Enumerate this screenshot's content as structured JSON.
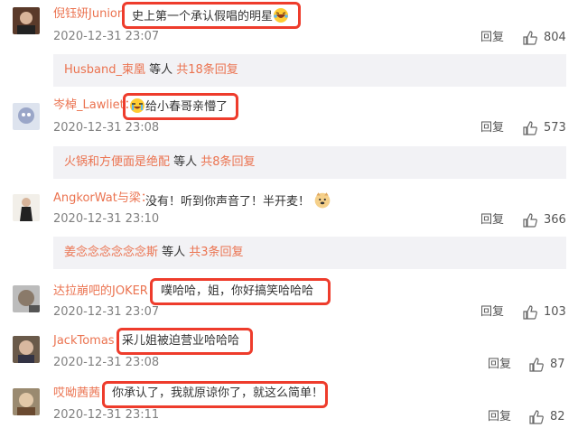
{
  "comments": [
    {
      "user": "倪钰妍Junior",
      "text": "史上第一个承认假唱的明星",
      "emoji_icon": "laughing-tears-emoji",
      "time": "2020-12-31 23:07",
      "reply": "回复",
      "likes": "804",
      "sub": {
        "name": "Husband_柬凰",
        "mid": " 等人 ",
        "count": "共18条回复"
      }
    },
    {
      "user": "岑棹_Lawliet",
      "sep": "：",
      "text": "给小春哥亲懵了",
      "emoji_icon": "crying-laugh-emoji",
      "time": "2020-12-31 23:08",
      "reply": "回复",
      "likes": "573",
      "sub": {
        "name": "火锅和方便面是绝配",
        "mid": " 等人 ",
        "count": "共8条回复"
      }
    },
    {
      "user": "AngkorWat与梁",
      "sep": "：",
      "text": "没有！听到你声音了！半开麦！",
      "emoji_icon": "doge-emoji",
      "time": "2020-12-31 23:10",
      "reply": "回复",
      "likes": "366",
      "sub": {
        "name": "姜念念念念念念斯",
        "mid": " 等人 ",
        "count": "共3条回复"
      }
    },
    {
      "user": "达拉崩吧的JOKER",
      "sep": "：",
      "text": "噗哈哈，姐，你好搞笑哈哈哈",
      "time": "2020-12-31 23:07",
      "reply": "回复",
      "likes": "103"
    },
    {
      "user": "JackTomas",
      "sep": "：",
      "text": "采儿姐被迫营业哈哈哈",
      "time": "2020-12-31 23:08",
      "reply": "回复",
      "likes": "87"
    },
    {
      "user": "哎呦茜茜",
      "sep": "：",
      "text": "你承认了，我就原谅你了，就这么简单！",
      "time": "2020-12-31 23:11",
      "reply": "回复",
      "likes": "82"
    }
  ],
  "colors": {
    "username": "#eb7350",
    "highlight": "#ee3c2c",
    "subbg": "#f2f2f5"
  }
}
